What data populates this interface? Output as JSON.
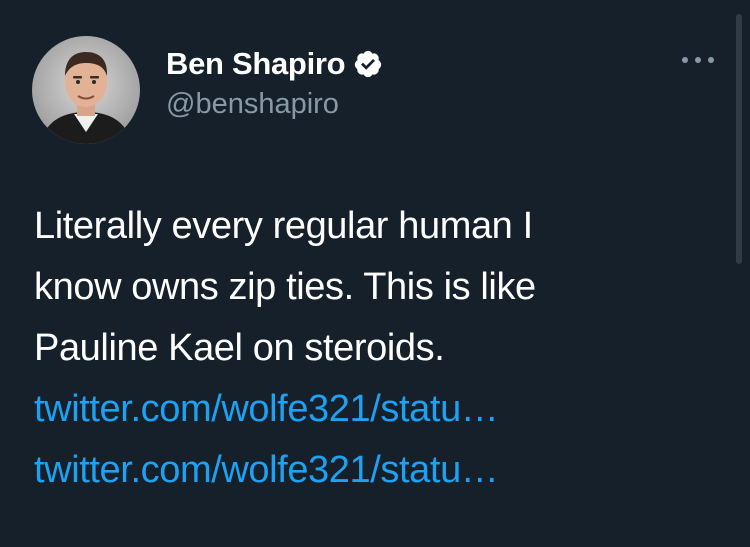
{
  "tweet": {
    "display_name": "Ben Shapiro",
    "handle": "@benshapiro",
    "text_lines": [
      "Literally every regular human I",
      "know owns zip ties. This is like",
      "Pauline Kael on steroids."
    ],
    "links": [
      "twitter.com/wolfe321/statu…",
      "twitter.com/wolfe321/statu…"
    ],
    "verified": true,
    "icons": {
      "verified": "verified-badge-icon",
      "more": "more-options-icon"
    }
  },
  "colors": {
    "background": "#15202b",
    "text": "#ffffff",
    "secondary": "#8899a6",
    "link": "#1da1f2"
  }
}
